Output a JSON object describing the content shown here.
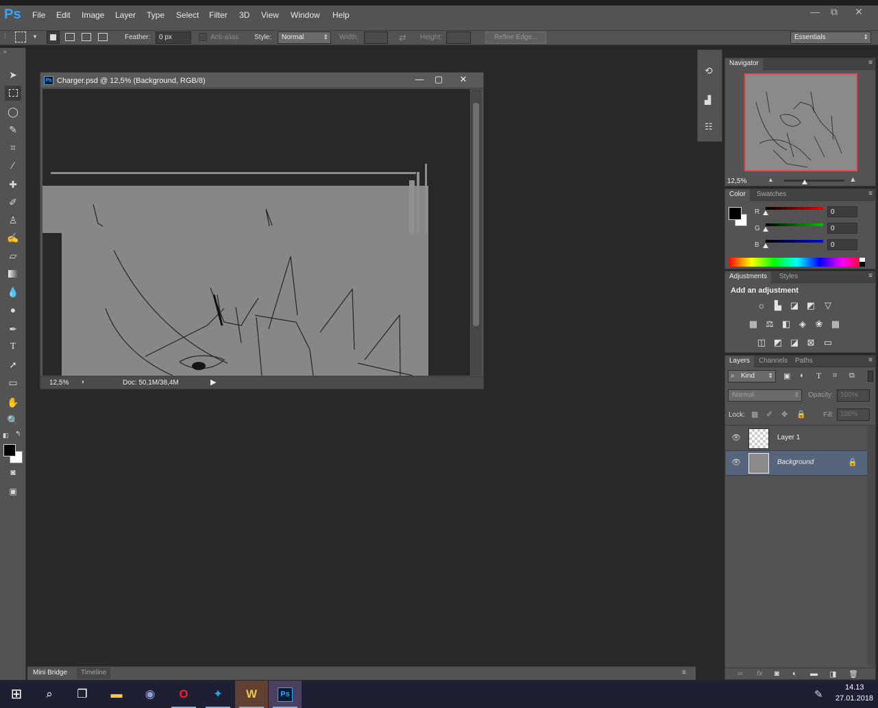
{
  "app": {
    "logo": "Ps"
  },
  "menu": [
    "File",
    "Edit",
    "Image",
    "Layer",
    "Type",
    "Select",
    "Filter",
    "3D",
    "View",
    "Window",
    "Help"
  ],
  "window_controls": {
    "minimize": "—",
    "restore": "⧉",
    "close": "✕"
  },
  "options": {
    "feather_label": "Feather:",
    "feather_value": "0 px",
    "antialias_label": "Anti-alias",
    "style_label": "Style:",
    "style_value": "Normal",
    "width_label": "Width:",
    "height_label": "Height:",
    "refine_edge": "Refine Edge...",
    "workspace": "Essentials"
  },
  "document": {
    "title": "Charger.psd @ 12,5% (Background, RGB/8)",
    "zoom": "12,5%",
    "doc_info": "Doc: 50,1M/38,4M"
  },
  "navigator": {
    "tab": "Navigator",
    "zoom": "12,5%"
  },
  "color_panel": {
    "tabs": [
      "Color",
      "Swatches"
    ],
    "channels": [
      {
        "label": "R",
        "value": "0",
        "color": "#e00000"
      },
      {
        "label": "G",
        "value": "0",
        "color": "#00c000"
      },
      {
        "label": "B",
        "value": "0",
        "color": "#0000e0"
      }
    ]
  },
  "adjustments": {
    "tabs": [
      "Adjustments",
      "Styles"
    ],
    "heading": "Add an adjustment"
  },
  "layers": {
    "tabs": [
      "Layers",
      "Channels",
      "Paths"
    ],
    "filter_kind": "Kind",
    "blend_mode": "Normal",
    "opacity_label": "Opacity:",
    "opacity_value": "100%",
    "lock_label": "Lock:",
    "fill_label": "Fill:",
    "fill_value": "100%",
    "items": [
      {
        "name": "Layer 1"
      },
      {
        "name": "Background"
      }
    ]
  },
  "bottom_tabs": [
    "Mini Bridge",
    "Timeline"
  ],
  "taskbar": {
    "time": "14.13",
    "date": "27.01.2018"
  },
  "colors": {
    "accent": "#31a8ff",
    "selected_layer": "#56657b",
    "chrome": "#535353",
    "canvas_bg": "#282828"
  }
}
